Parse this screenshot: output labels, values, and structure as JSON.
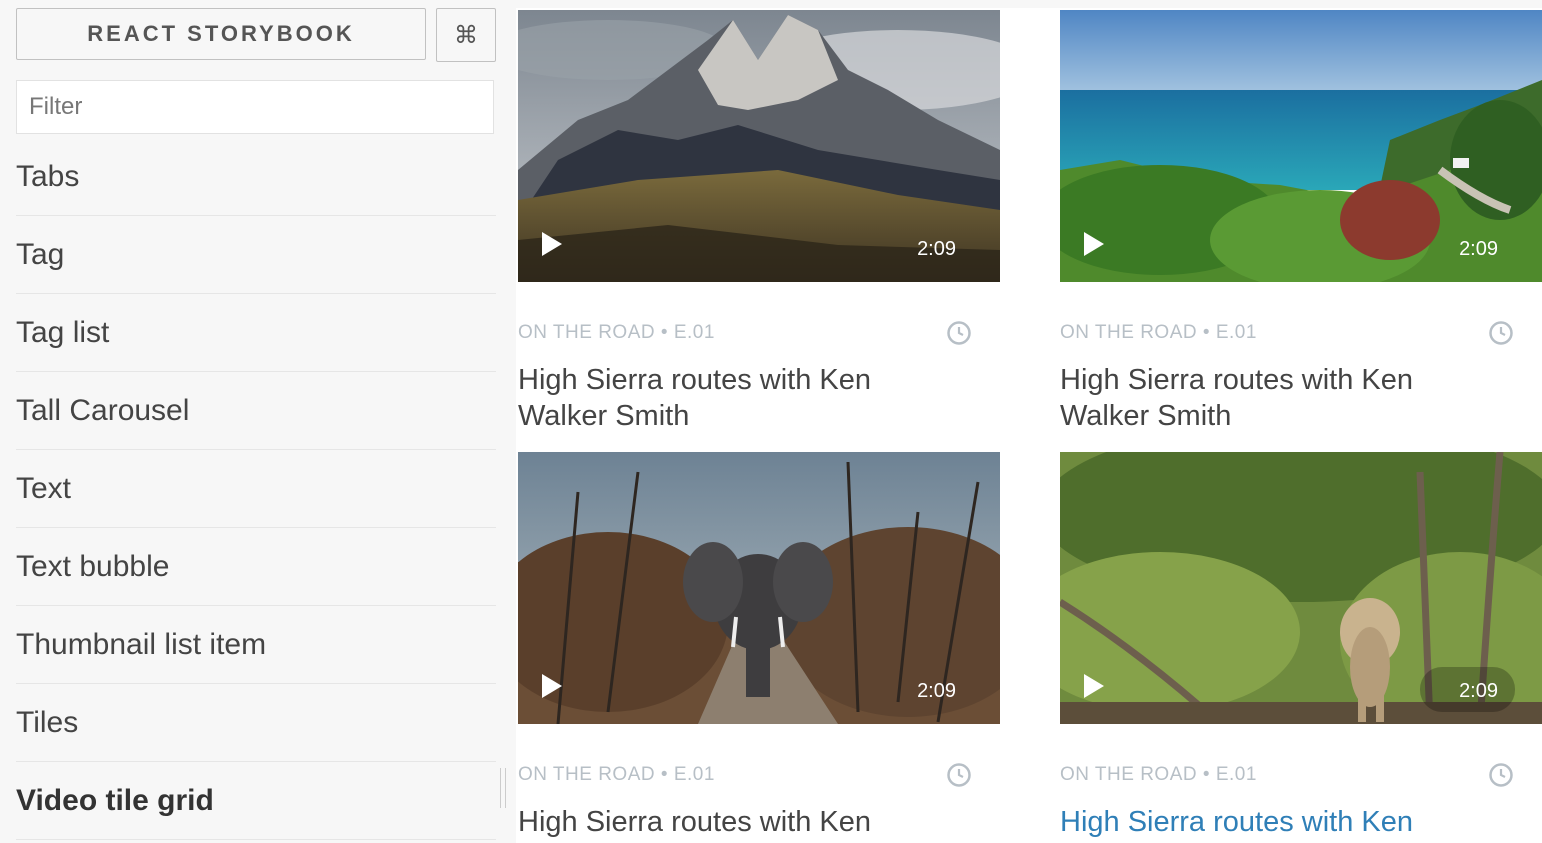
{
  "sidebar": {
    "title": "REACT STORYBOOK",
    "shortcut_icon": "command-icon",
    "shortcut_glyph": "⌘",
    "filter_placeholder": "Filter",
    "items": [
      {
        "label": "Tabs"
      },
      {
        "label": "Tag"
      },
      {
        "label": "Tag list"
      },
      {
        "label": "Tall Carousel"
      },
      {
        "label": "Text"
      },
      {
        "label": "Text bubble"
      },
      {
        "label": "Thumbnail list item"
      },
      {
        "label": "Tiles"
      },
      {
        "label": "Video tile grid",
        "active": true
      }
    ]
  },
  "tiles": [
    {
      "scene": "mountains",
      "duration": "2:09",
      "meta": "ON THE ROAD • E.01",
      "title": "High Sierra routes with Ken Walker Smith"
    },
    {
      "scene": "coast",
      "duration": "2:09",
      "meta": "ON THE ROAD • E.01",
      "title": "High Sierra routes with Ken Walker Smith"
    },
    {
      "scene": "elephant",
      "duration": "2:09",
      "meta": "ON THE ROAD • E.01",
      "title": "High Sierra routes with Ken Walker Smith"
    },
    {
      "scene": "lion",
      "duration": "2:09",
      "meta": "ON THE ROAD • E.01",
      "title": "High Sierra routes with Ken Walker Smith",
      "hovered": true
    }
  ],
  "colors": {
    "link_hover": "#2f7fb7",
    "meta_text": "#b7bfc6",
    "sidebar_bg": "#f7f7f7"
  }
}
